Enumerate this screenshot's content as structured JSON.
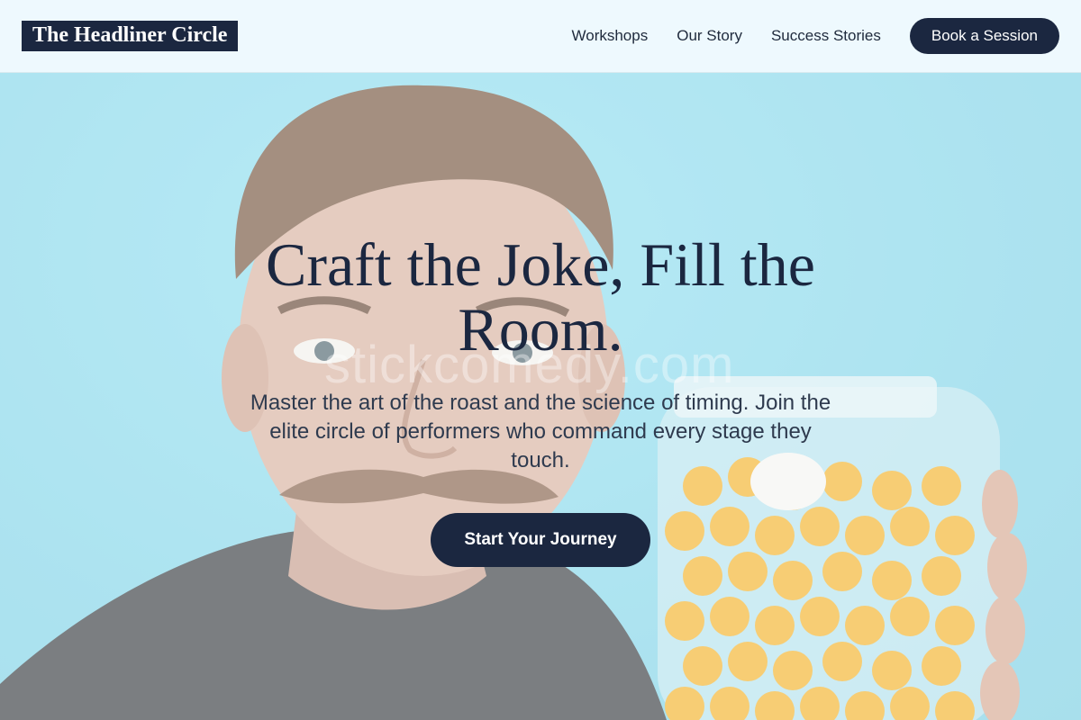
{
  "brand": {
    "name": "The Headliner Circle"
  },
  "nav": {
    "links": [
      "Workshops",
      "Our Story",
      "Success Stories"
    ],
    "cta_label": "Book a Session"
  },
  "hero": {
    "title": "Craft the Joke, Fill the Room.",
    "subtitle": "Master the art of the roast and the science of timing. Join the elite circle of performers who command every stage they touch.",
    "cta_label": "Start Your Journey",
    "watermark": "stickcomedy.com",
    "image_subject": "man-holding-jar-of-cheese-balls"
  },
  "colors": {
    "primary": "#1b2740",
    "header_bg": "#f0fafe",
    "hero_bg": "#8fdcec",
    "text_muted": "#2e3a4e"
  }
}
